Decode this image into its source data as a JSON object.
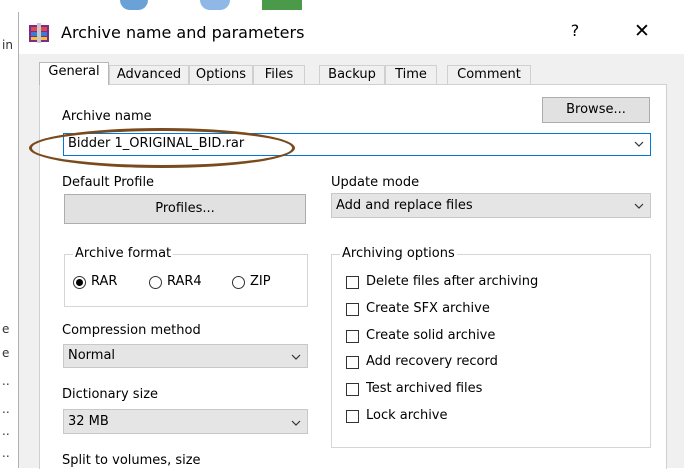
{
  "background": {
    "left_fragments": [
      "in",
      "e",
      "e",
      "..",
      "..",
      "..",
      ".."
    ]
  },
  "window": {
    "title": "Archive name and parameters",
    "help_label": "?",
    "close_label": "✕"
  },
  "tabs": [
    {
      "label": "General",
      "active": true
    },
    {
      "label": "Advanced",
      "active": false
    },
    {
      "label": "Options",
      "active": false
    },
    {
      "label": "Files",
      "active": false
    },
    {
      "label": "Backup",
      "active": false
    },
    {
      "label": "Time",
      "active": false
    },
    {
      "label": "Comment",
      "active": false
    }
  ],
  "general": {
    "archive_name_label": "Archive name",
    "browse_label": "Browse...",
    "archive_name_value": "Bidder 1_ORIGINAL_BID.rar",
    "default_profile_label": "Default Profile",
    "profiles_label": "Profiles...",
    "update_mode_label": "Update mode",
    "update_mode_value": "Add and replace files",
    "archive_format": {
      "title": "Archive format",
      "options": [
        "RAR",
        "RAR4",
        "ZIP"
      ],
      "selected": "RAR"
    },
    "archiving_options": {
      "title": "Archiving options",
      "items": [
        {
          "label": "Delete files after archiving",
          "checked": false
        },
        {
          "label": "Create SFX archive",
          "checked": false
        },
        {
          "label": "Create solid archive",
          "checked": false
        },
        {
          "label": "Add recovery record",
          "checked": false
        },
        {
          "label": "Test archived files",
          "checked": false
        },
        {
          "label": "Lock archive",
          "checked": false
        }
      ]
    },
    "compression_method_label": "Compression method",
    "compression_method_value": "Normal",
    "dictionary_size_label": "Dictionary size",
    "dictionary_size_value": "32 MB",
    "split_label": "Split to volumes, size"
  },
  "colors": {
    "annotation_ellipse": "#7a4a1c",
    "selection_blue": "#0078d7"
  }
}
